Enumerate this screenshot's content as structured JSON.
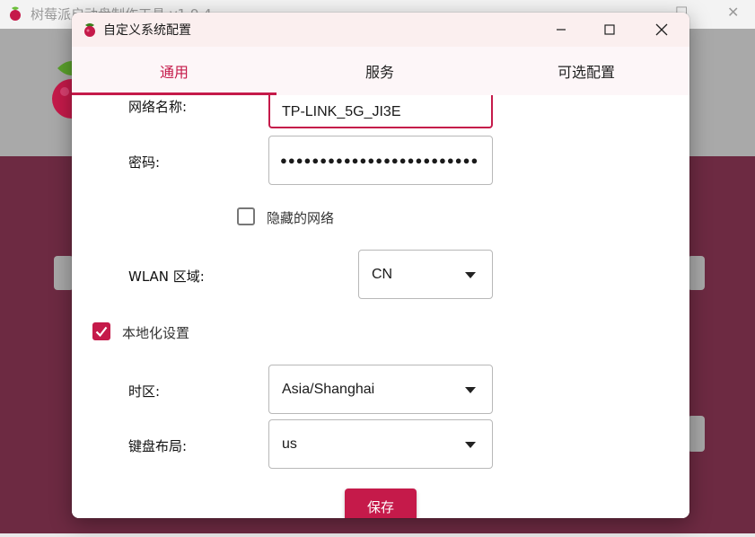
{
  "background_window": {
    "title": "树莓派启动盘制作工具 v1.9.4"
  },
  "dialog": {
    "title": "自定义系统配置",
    "tabs": [
      {
        "label": "通用",
        "active": true
      },
      {
        "label": "服务",
        "active": false
      },
      {
        "label": "可选配置",
        "active": false
      }
    ]
  },
  "form": {
    "ssid_label": "网络名称:",
    "ssid_value": "TP-LINK_5G_JI3E",
    "password_label": "密码:",
    "password_mask": "●●●●●●●●●●●●●●●●●●●●●●●●●",
    "hidden_network_label": "隐藏的网络",
    "hidden_network_checked": false,
    "wlan_region_label": "WLAN 区域:",
    "wlan_region_value": "CN",
    "locale_label": "本地化设置",
    "locale_checked": true,
    "timezone_label": "时区:",
    "timezone_value": "Asia/Shanghai",
    "keyboard_label": "键盘布局:",
    "keyboard_value": "us",
    "save_label": "保存"
  },
  "colors": {
    "accent": "#c51a4a",
    "background_maroon": "#6d2a42",
    "background_grey": "#a9a9a9"
  },
  "icons": [
    "raspberry-logo-icon",
    "minimize-icon",
    "maximize-icon",
    "close-icon",
    "dropdown-caret-icon",
    "checkmark-icon"
  ]
}
